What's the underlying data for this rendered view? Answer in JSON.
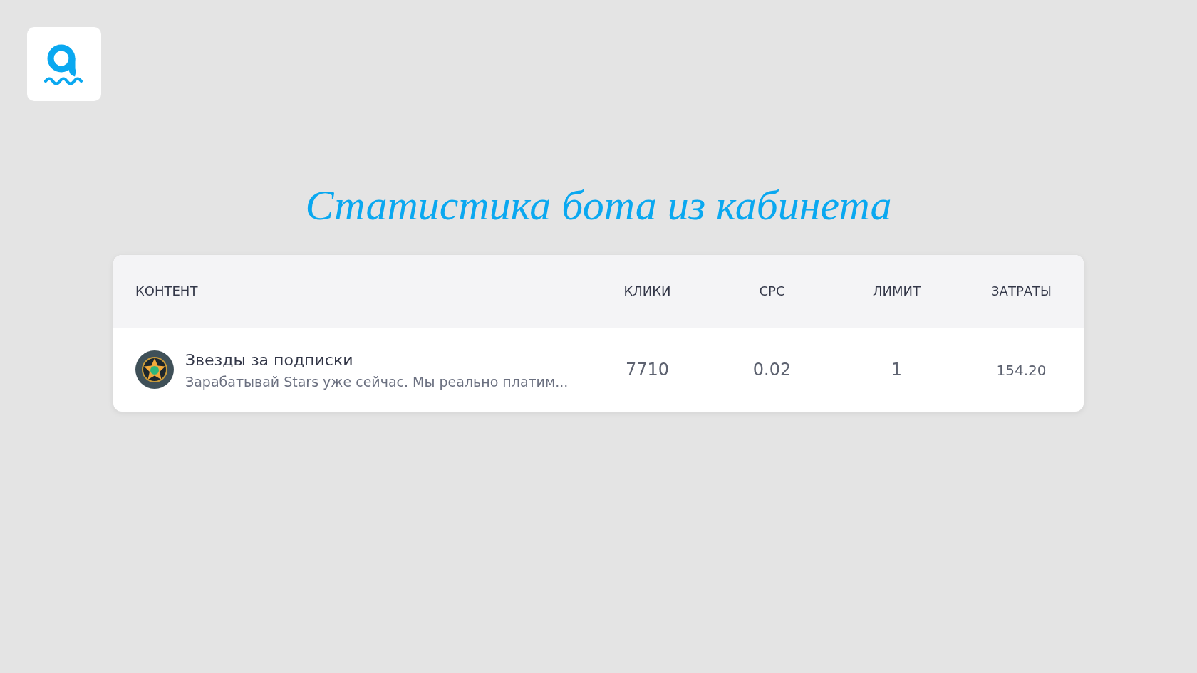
{
  "title": "Статистика бота из кабинета",
  "table": {
    "columns": [
      "КОНТЕНТ",
      "КЛИКИ",
      "CPC",
      "ЛИМИТ",
      "ЗАТРАТЫ"
    ],
    "rows": [
      {
        "name": "Звезды за подписки",
        "description": "Зарабатывай Stars уже сейчас. Мы реально платим...",
        "clicks": "7710",
        "cpc": "0.02",
        "limit": "1",
        "spend": "154.20"
      }
    ]
  }
}
